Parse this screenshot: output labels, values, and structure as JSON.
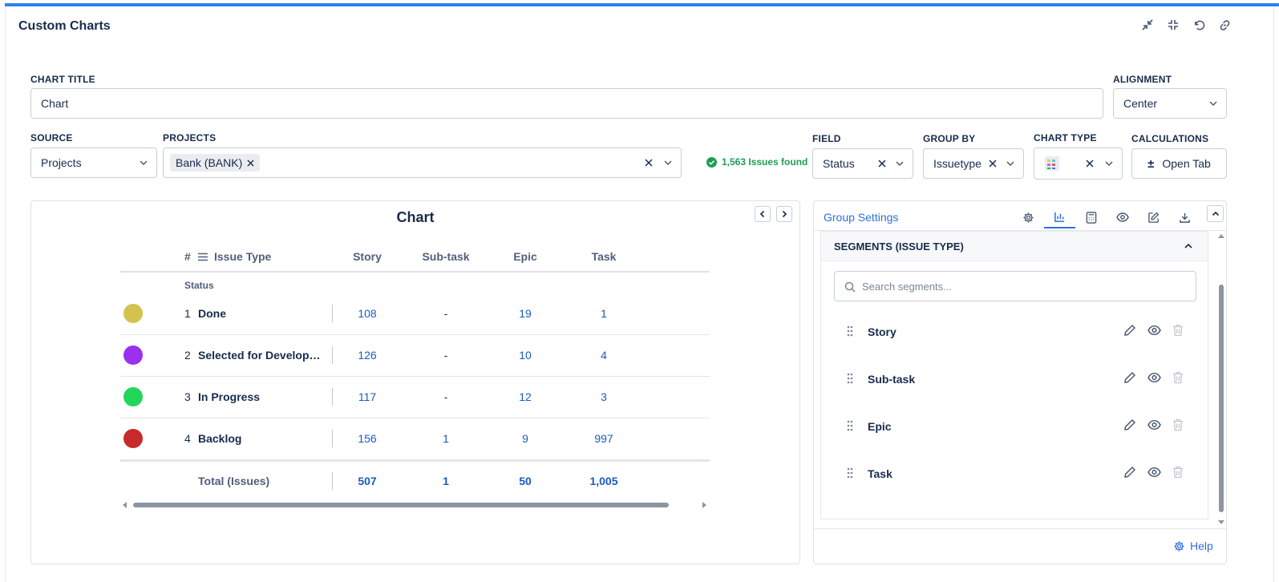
{
  "app": {
    "title": "Custom Charts"
  },
  "form": {
    "chart_title_label": "CHART TITLE",
    "chart_title_value": "Chart",
    "alignment_label": "ALIGNMENT",
    "alignment_value": "Center",
    "source_label": "SOURCE",
    "source_value": "Projects",
    "projects_label": "PROJECTS",
    "project_tag": "Bank (BANK)",
    "issues_found": "1,563 Issues found",
    "field_label": "FIELD",
    "field_value": "Status",
    "groupby_label": "GROUP BY",
    "groupby_value": "Issuetype",
    "charttype_label": "CHART TYPE",
    "calculations_label": "CALCULATIONS",
    "calculations_button": "Open Tab"
  },
  "chart": {
    "title": "Chart",
    "header_hash": "#",
    "header_issue_type": "Issue Type",
    "status_label": "Status",
    "columns": [
      "Story",
      "Sub-task",
      "Epic",
      "Task"
    ],
    "rows": [
      {
        "num": "1",
        "name": "Done",
        "color": "#d4c24f",
        "values": [
          "108",
          "-",
          "19",
          "1"
        ]
      },
      {
        "num": "2",
        "name": "Selected for Developm...",
        "color": "#9b30f0",
        "values": [
          "126",
          "-",
          "10",
          "4"
        ]
      },
      {
        "num": "3",
        "name": "In Progress",
        "color": "#22d65a",
        "values": [
          "117",
          "-",
          "12",
          "3"
        ]
      },
      {
        "num": "4",
        "name": "Backlog",
        "color": "#c62a2a",
        "values": [
          "156",
          "1",
          "9",
          "997"
        ]
      }
    ],
    "total_label": "Total (Issues)",
    "totals": [
      "507",
      "1",
      "50",
      "1,005"
    ]
  },
  "group_settings": {
    "title": "Group Settings",
    "segments_header": "SEGMENTS (ISSUE TYPE)",
    "search_placeholder": "Search segments...",
    "segments": [
      "Story",
      "Sub-task",
      "Epic",
      "Task"
    ],
    "help": "Help"
  },
  "colors": {
    "accent": "#2f80ed",
    "link": "#1a5bbd",
    "success": "#1f9d55"
  }
}
